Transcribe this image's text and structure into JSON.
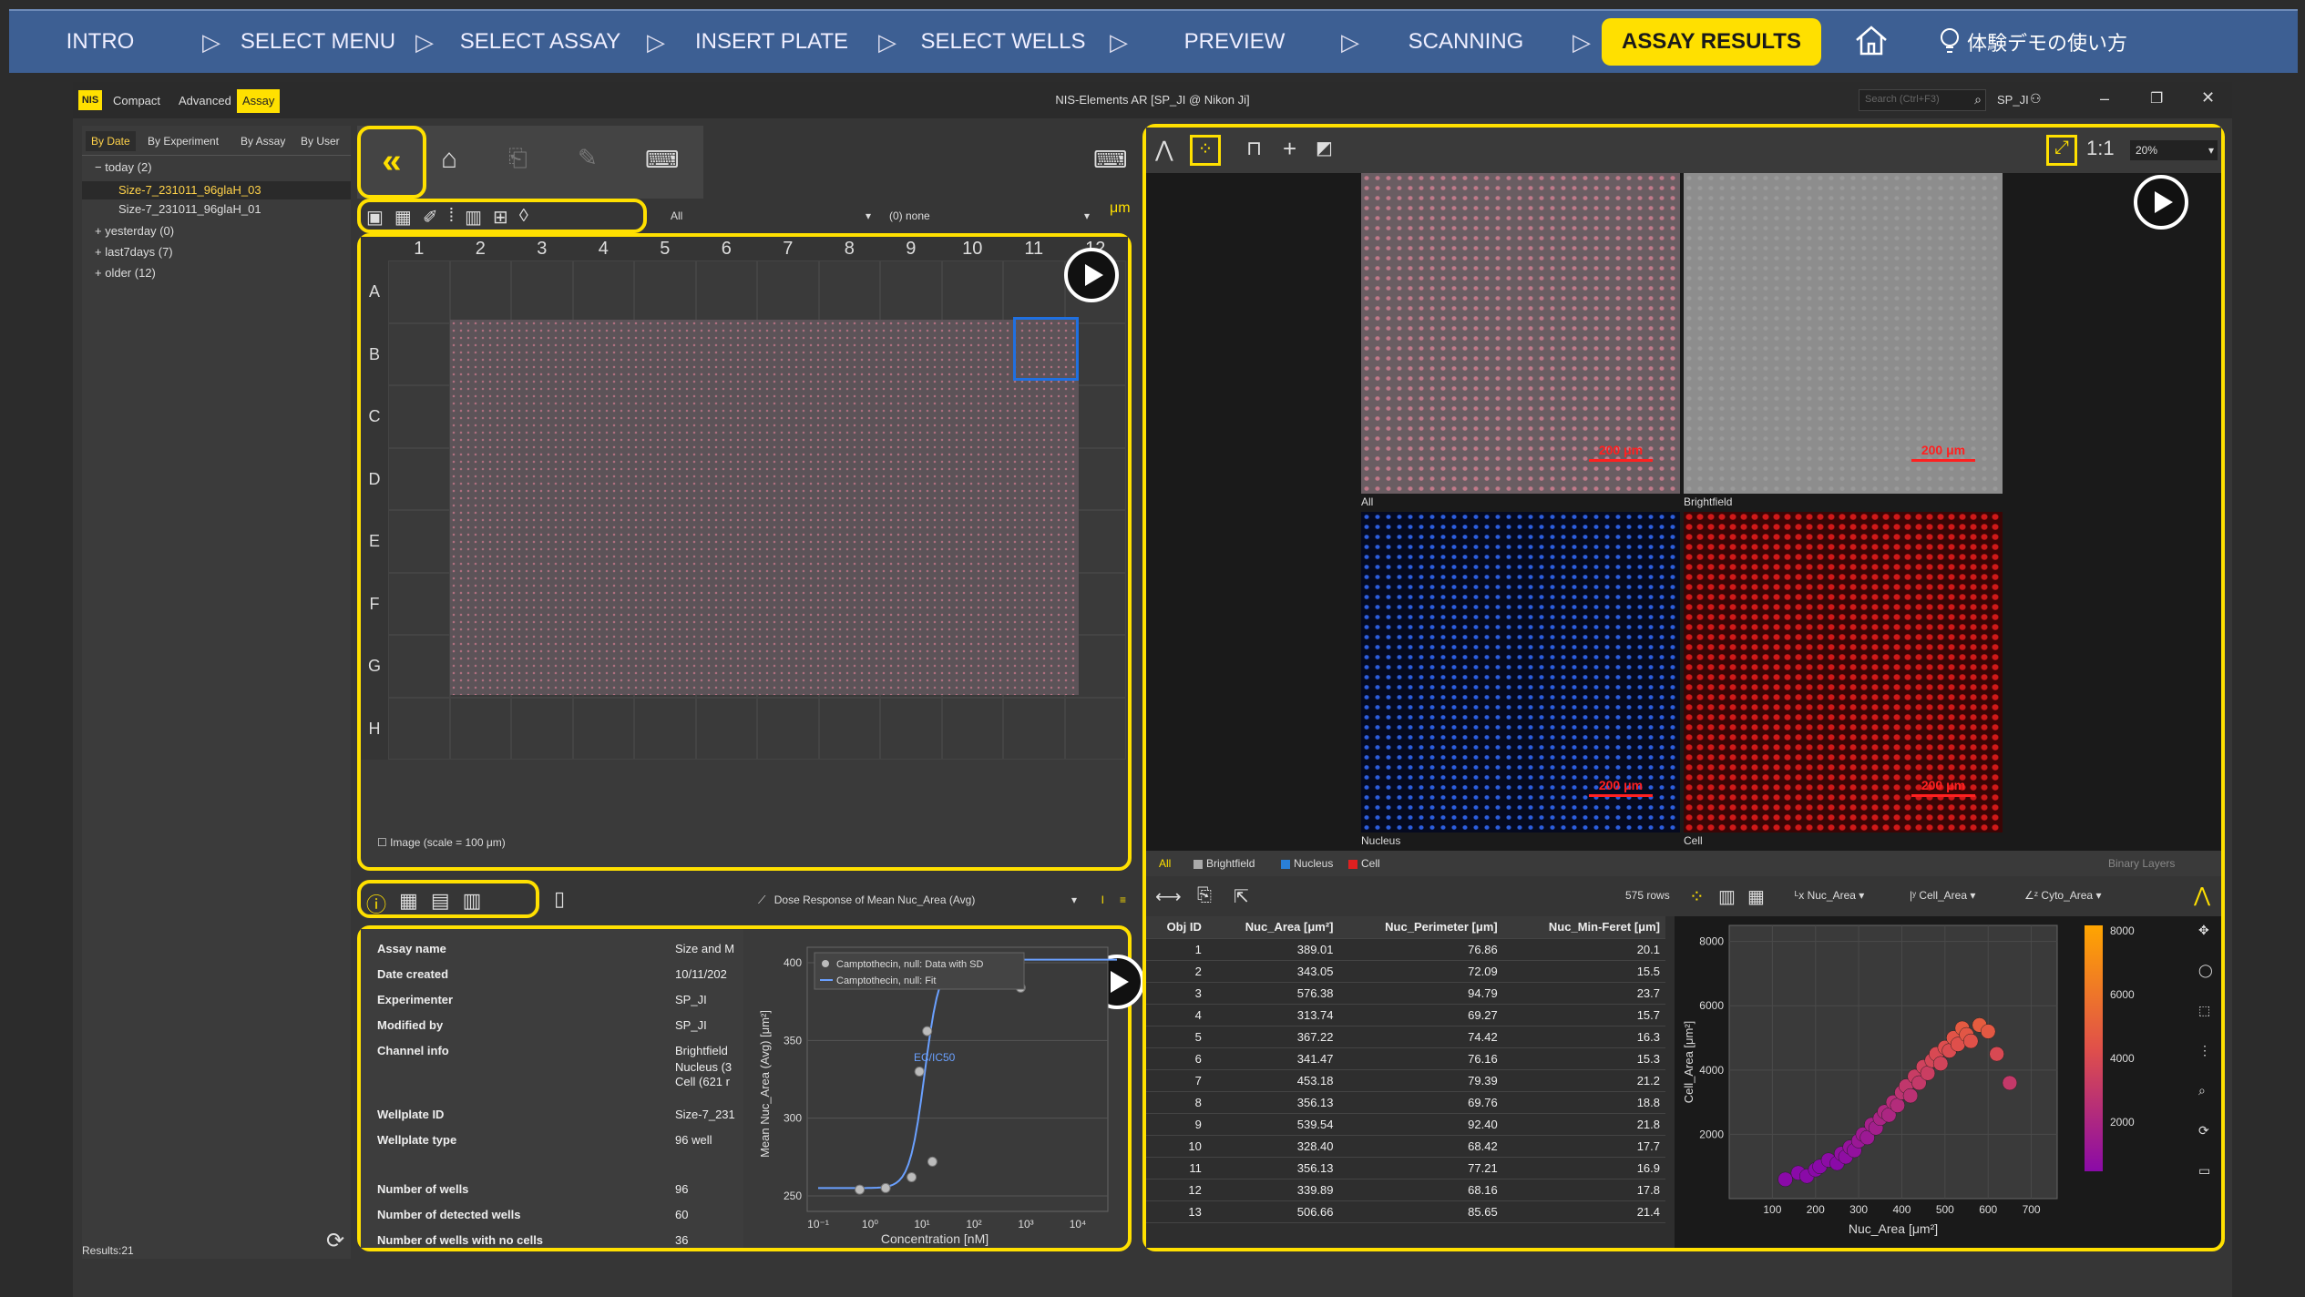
{
  "nav": {
    "steps": [
      "INTRO",
      "SELECT MENU",
      "SELECT ASSAY",
      "INSERT PLATE",
      "SELECT WELLS",
      "PREVIEW",
      "SCANNING",
      "ASSAY RESULTS"
    ],
    "arrow": "▷",
    "home_icon": "home-icon",
    "help_label": "体験デモの使い方"
  },
  "window": {
    "logo": "NIS",
    "tabs": [
      "Compact",
      "Advanced",
      "Assay"
    ],
    "title": "NIS-Elements AR [SP_JI @ Nikon Ji]",
    "search_placeholder": "Search (Ctrl+F3)",
    "user": "SP_JI",
    "accent": "#ffe000"
  },
  "sidebar": {
    "tabs": [
      "By Date",
      "By Experiment",
      "By Assay",
      "By User"
    ],
    "tree": [
      {
        "label": "today (2)",
        "prefix": "−"
      },
      {
        "label": "Size-7_231011_96glaH_03",
        "child": true,
        "selected": true
      },
      {
        "label": "Size-7_231011_96glaH_01",
        "child": true
      },
      {
        "label": "yesterday (0)",
        "prefix": "+"
      },
      {
        "label": "last7days (7)",
        "prefix": "+"
      },
      {
        "label": "older (12)",
        "prefix": "+"
      }
    ],
    "results": "Results:21"
  },
  "plate": {
    "filter_value": "All",
    "channel_value": "(0) none",
    "columns": [
      "1",
      "2",
      "3",
      "4",
      "5",
      "6",
      "7",
      "8",
      "9",
      "10",
      "11",
      "12"
    ],
    "rows": [
      "A",
      "B",
      "C",
      "D",
      "E",
      "F",
      "G",
      "H"
    ],
    "image_checkbox": "Image (scale = 100 μm)"
  },
  "info": {
    "graph_select": "Dose Response of Mean Nuc_Area (Avg)",
    "rows": [
      {
        "k": "Assay name",
        "v": "Size and M"
      },
      {
        "k": "Date created",
        "v": "10/11/202"
      },
      {
        "k": "Experimenter",
        "v": "SP_JI"
      },
      {
        "k": "Modified by",
        "v": "SP_JI"
      },
      {
        "k": "Channel info",
        "v": "Brightfield"
      },
      {
        "k": "",
        "v": "Nucleus (3"
      },
      {
        "k": "",
        "v": "Cell (621 r"
      },
      {
        "k": "Wellplate ID",
        "v": "Size-7_231"
      },
      {
        "k": "Wellplate type",
        "v": "96 well"
      },
      {
        "k": "Number of wells",
        "v": "96"
      },
      {
        "k": "Number of detected wells",
        "v": "60"
      },
      {
        "k": "Number of wells with no cells",
        "v": "36"
      }
    ]
  },
  "dose_chart": {
    "legend": [
      "Camptothecin, null: Data with SD",
      "Camptothecin, null: Fit"
    ],
    "ylabel": "Mean Nuc_Area (Avg) [μm²]",
    "xlabel": "Concentration [nM]",
    "annotation": "EC/IC50",
    "yticks": [
      "250",
      "300",
      "350",
      "400"
    ],
    "xticks": [
      "10⁻¹",
      "10⁰",
      "10¹",
      "10²",
      "10³",
      "10⁴"
    ]
  },
  "viewer": {
    "zoom": "20%",
    "ratio": "1:1",
    "tiles": [
      {
        "label": "All",
        "scale": "200 μm"
      },
      {
        "label": "Brightfield",
        "scale": "200 μm"
      },
      {
        "label": "Nucleus",
        "scale": "200 μm"
      },
      {
        "label": "Cell",
        "scale": "200 μm"
      }
    ],
    "channels": [
      "All",
      "Brightfield",
      "Nucleus",
      "Cell"
    ],
    "binary_layers": "Binary Layers",
    "channel_colors": [
      "#aaaaaa",
      "#2a7fd6",
      "#e02020"
    ]
  },
  "results": {
    "rows_count": "575 rows",
    "headers": [
      "Obj ID",
      "Nuc_Area [μm²]",
      "Nuc_Perimeter [μm]",
      "Nuc_Min-Feret [μm]"
    ],
    "rows": [
      [
        "1",
        "389.01",
        "76.86",
        "20.1"
      ],
      [
        "2",
        "343.05",
        "72.09",
        "15.5"
      ],
      [
        "3",
        "576.38",
        "94.79",
        "23.7"
      ],
      [
        "4",
        "313.74",
        "69.27",
        "15.7"
      ],
      [
        "5",
        "367.22",
        "74.42",
        "16.3"
      ],
      [
        "6",
        "341.47",
        "76.16",
        "15.3"
      ],
      [
        "7",
        "453.18",
        "79.39",
        "21.2"
      ],
      [
        "8",
        "356.13",
        "69.76",
        "18.8"
      ],
      [
        "9",
        "539.54",
        "92.40",
        "21.8"
      ],
      [
        "10",
        "328.40",
        "68.42",
        "17.7"
      ],
      [
        "11",
        "356.13",
        "77.21",
        "16.9"
      ],
      [
        "12",
        "339.89",
        "68.16",
        "17.8"
      ],
      [
        "13",
        "506.66",
        "85.65",
        "21.4"
      ]
    ]
  },
  "scatter": {
    "x_select": "Nuc_Area",
    "y_select": "Cell_Area",
    "z_select": "Cyto_Area",
    "xlabel": "Nuc_Area [μm²]",
    "ylabel": "Cell_Area [μm²]",
    "xticks": [
      "100",
      "200",
      "300",
      "400",
      "500",
      "600",
      "700"
    ],
    "yticks": [
      "2000",
      "4000",
      "6000",
      "8000"
    ],
    "colorbar_ticks": [
      "8000",
      "6000",
      "4000",
      "2000"
    ]
  },
  "chart_data": {
    "type": "scatter",
    "title": "",
    "xlabel": "Nuc_Area [μm²]",
    "ylabel": "Cell_Area [μm²]",
    "xlim": [
      0,
      760
    ],
    "ylim": [
      0,
      8500
    ],
    "series": [
      {
        "x": [
          130,
          160,
          180,
          200,
          210,
          230,
          250,
          260,
          270,
          280,
          290,
          300,
          310,
          320,
          330,
          340,
          350,
          360,
          370,
          380,
          390,
          400,
          410,
          420,
          430,
          440,
          450,
          460,
          470,
          480,
          490,
          500,
          510,
          520,
          530,
          540,
          550,
          560,
          580,
          600,
          620,
          650
        ],
        "y": [
          600,
          800,
          700,
          900,
          1000,
          1200,
          1100,
          1400,
          1300,
          1600,
          1500,
          1800,
          2000,
          1900,
          2300,
          2200,
          2500,
          2700,
          2600,
          3000,
          2900,
          3300,
          3500,
          3200,
          3800,
          3600,
          4100,
          3900,
          4300,
          4500,
          4200,
          4700,
          4600,
          5000,
          4800,
          5300,
          5100,
          4900,
          5400,
          5200,
          4500,
          3600
        ],
        "z": [
          600,
          700,
          650,
          800,
          900,
          1100,
          1000,
          1300,
          1200,
          1500,
          1400,
          1700,
          1900,
          1800,
          2200,
          2100,
          2400,
          2600,
          2500,
          2900,
          2800,
          3200,
          3400,
          3100,
          3700,
          3500,
          4000,
          3800,
          4200,
          4400,
          4100,
          4600,
          4500,
          4900,
          4700,
          5200,
          5000,
          4800,
          5300,
          5100,
          4400,
          3500
        ]
      }
    ],
    "colorbar": {
      "min": 1000,
      "max": 8500,
      "colors": [
        "#8a0aa8",
        "#e0504a",
        "#ffa500"
      ]
    }
  }
}
